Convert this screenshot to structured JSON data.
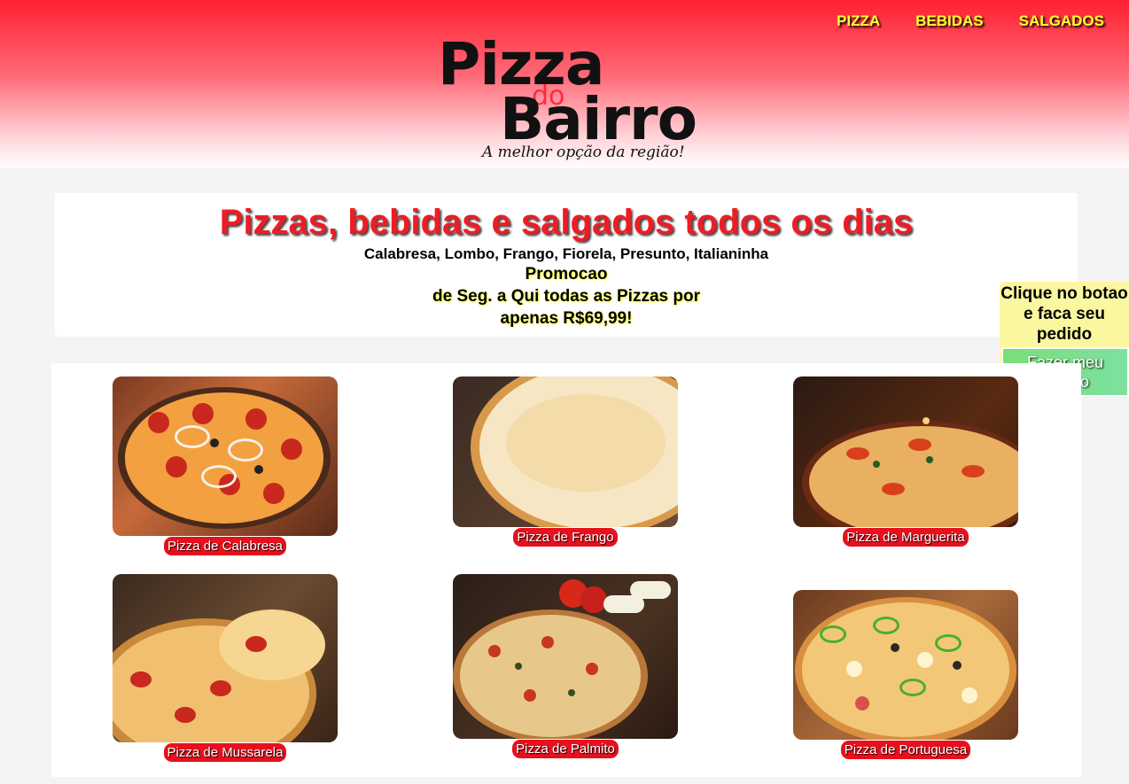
{
  "nav": {
    "items": [
      "PIZZA",
      "BEBIDAS",
      "SALGADOS"
    ]
  },
  "logo": {
    "line1": "Pizza",
    "line2": "do",
    "line3": "Bairro",
    "tagline": "A melhor opção da região!"
  },
  "hero": {
    "title": "Pizzas, bebidas e salgados todos os dias",
    "flavors": "Calabresa, Lombo, Frango, Fiorela, Presunto, Italianinha",
    "promo_line1": "Promocao",
    "promo_line2": "de Seg. a Qui todas as Pizzas por apenas R$69,99!"
  },
  "side_panel": {
    "text": "Clique no botao e faca seu pedido",
    "button": "Fazer meu pedido"
  },
  "products": [
    {
      "label": "Pizza de Calabresa"
    },
    {
      "label": "Pizza de Frango"
    },
    {
      "label": "Pizza de Marguerita"
    },
    {
      "label": "Pizza de Mussarela"
    },
    {
      "label": "Pizza de Palmito"
    },
    {
      "label": "Pizza de Portuguesa"
    }
  ],
  "colors": {
    "brand_red": "#ee1c25",
    "nav_yellow": "#ffff33",
    "promo_yellow": "#fbf7a0",
    "button_green": "#78df78"
  }
}
